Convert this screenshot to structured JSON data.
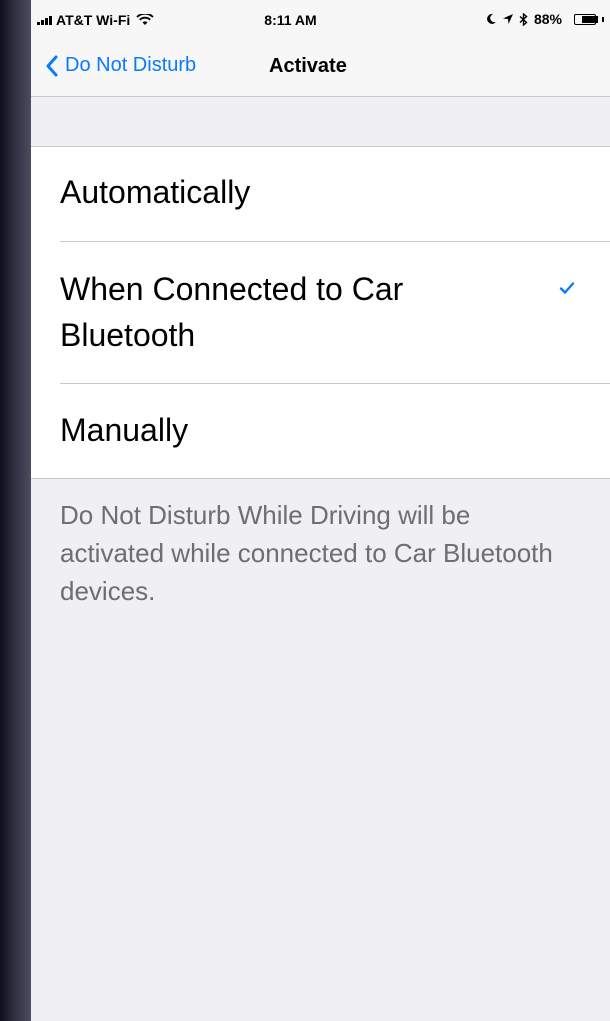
{
  "status_bar": {
    "carrier": "AT&T Wi-Fi",
    "time": "8:11 AM",
    "battery": "88%"
  },
  "nav": {
    "back_label": "Do Not Disturb",
    "title": "Activate"
  },
  "options": [
    {
      "label": "Automatically",
      "selected": false
    },
    {
      "label": "When Connected to Car Bluetooth",
      "selected": true
    },
    {
      "label": "Manually",
      "selected": false
    }
  ],
  "footer": "Do Not Disturb While Driving will be activated while connected to Car Bluetooth devices.",
  "colors": {
    "accent": "#0a7aff",
    "background": "#efeff4"
  },
  "icons": [
    "signal-icon",
    "wifi-icon",
    "moon-icon",
    "location-icon",
    "bluetooth-icon",
    "battery-icon",
    "chevron-left-icon",
    "checkmark-icon"
  ]
}
